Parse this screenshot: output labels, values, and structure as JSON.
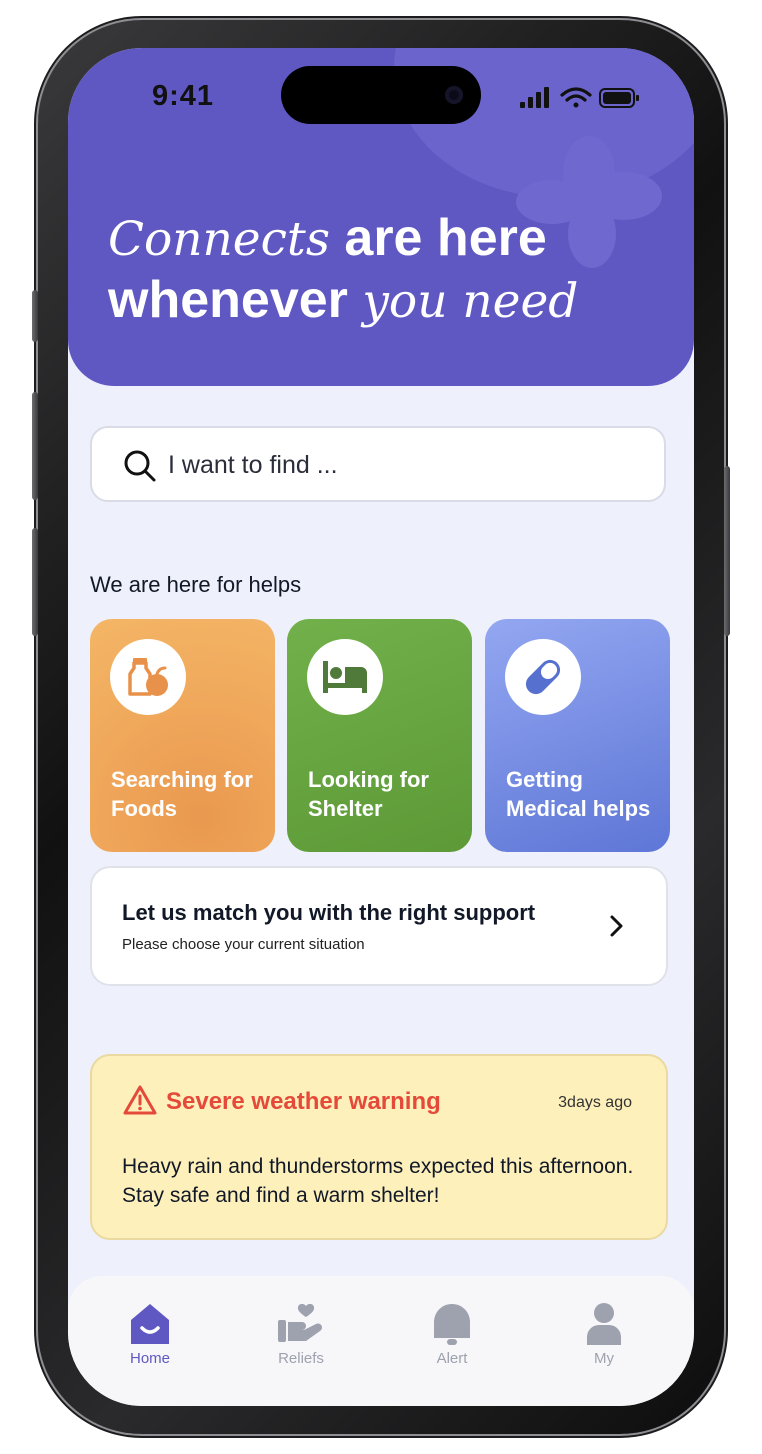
{
  "status_bar": {
    "time": "9:41"
  },
  "hero": {
    "line1_italic": "Connects",
    "line1_rest": " are here",
    "line2_rest": "whenever ",
    "line2_italic": "you need"
  },
  "search": {
    "placeholder": "I want to find ..."
  },
  "section_title": "We are here for helps",
  "categories": [
    {
      "label": "Searching for\nFoods",
      "icon": "food-icon"
    },
    {
      "label": "Looking for\nShelter",
      "icon": "bed-icon"
    },
    {
      "label": "Getting\nMedical helps",
      "icon": "pill-icon"
    }
  ],
  "match": {
    "title": "Let us match you with the right support",
    "subtitle": "Please choose your current situation"
  },
  "warning": {
    "title": "Severe weather warning",
    "time": "3days ago",
    "body": "Heavy rain and thunderstorms expected this afternoon. Stay safe and find a warm shelter!"
  },
  "tabs": [
    {
      "label": "Home",
      "icon": "home-icon",
      "active": true
    },
    {
      "label": "Reliefs",
      "icon": "relief-icon",
      "active": false
    },
    {
      "label": "Alert",
      "icon": "bell-icon",
      "active": false
    },
    {
      "label": "My",
      "icon": "person-icon",
      "active": false
    }
  ],
  "colors": {
    "accent": "#5f58c3",
    "food": "#f0a75a",
    "shelter": "#65a63f",
    "medical": "#7a8fe6",
    "warning_bg": "#fdf0bb",
    "warning_text": "#e5493a"
  }
}
